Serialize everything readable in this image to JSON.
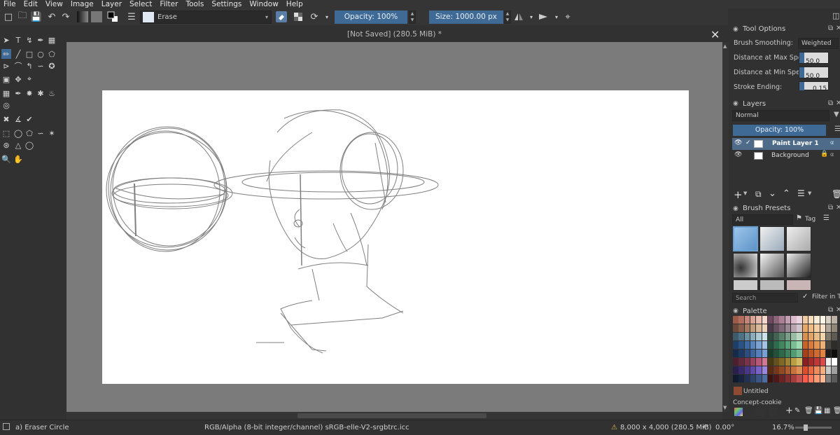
{
  "menubar": {
    "items": [
      "File",
      "Edit",
      "View",
      "Image",
      "Layer",
      "Select",
      "Filter",
      "Tools",
      "Settings",
      "Window",
      "Help"
    ]
  },
  "toolbar": {
    "brush_name": "Erase",
    "opacity_label": "Opacity: 100%",
    "size_label": "Size: 1000.00 px"
  },
  "document": {
    "title": "[Not Saved]  (280.5 MiB) *"
  },
  "tool_options": {
    "title": "Tool Options",
    "brush_smoothing_label": "Brush Smoothing:",
    "brush_smoothing_value": "Weighted",
    "distance_max_label": "Distance at Max Speed:",
    "distance_max_value": "50.0",
    "distance_min_label": "Distance at Min Speed:",
    "distance_min_value": "50.0",
    "stroke_ending_label": "Stroke Ending:",
    "stroke_ending_value": "0.15"
  },
  "layers": {
    "title": "Layers",
    "blend_mode": "Normal",
    "opacity_label": "Opacity: 100%",
    "items": [
      {
        "name": "Paint Layer 1"
      },
      {
        "name": "Background"
      }
    ]
  },
  "brush_presets": {
    "title": "Brush Presets",
    "filter_value": "All",
    "tag_label": "Tag",
    "search_placeholder": "Search",
    "filter_in_tag_label": "Filter in Tag"
  },
  "palette": {
    "title": "Palette",
    "current_color_name": "Untitled",
    "palette_name": "Concept-cookie"
  },
  "status": {
    "tool": "a) Eraser Circle",
    "color_space": "RGB/Alpha (8-bit integer/channel)  sRGB-elle-V2-srgbtrc.icc",
    "image_size": "8,000 x 4,000 (280.5 MiB)",
    "rotation": "0.00°",
    "zoom": "16.7%"
  },
  "colors": {
    "accent": "#3f6a96",
    "canvas_bg": "#7b7b7b",
    "panel_bg": "#313131",
    "swatch_brown": "#8e4b33"
  }
}
